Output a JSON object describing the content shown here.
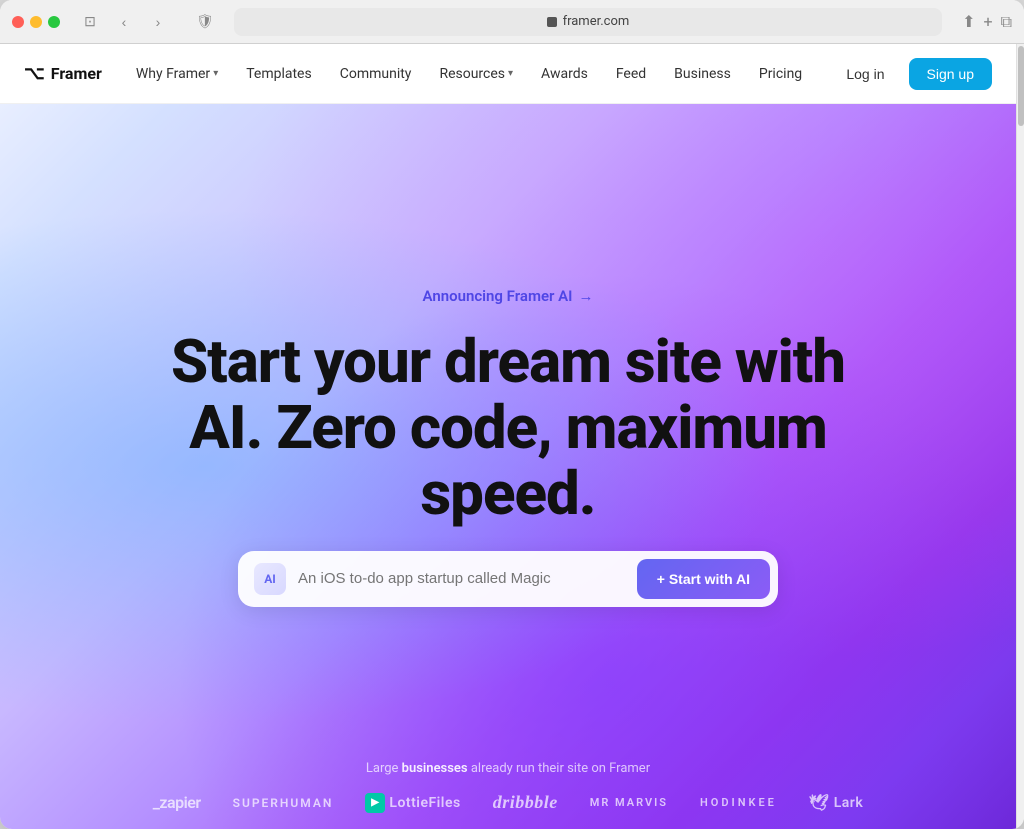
{
  "browser": {
    "url": "framer.com",
    "scrollbar_visible": true
  },
  "navbar": {
    "logo_label": "Framer",
    "links": [
      {
        "label": "Why Framer",
        "has_dropdown": true
      },
      {
        "label": "Templates",
        "has_dropdown": false
      },
      {
        "label": "Community",
        "has_dropdown": false
      },
      {
        "label": "Resources",
        "has_dropdown": true
      },
      {
        "label": "Awards",
        "has_dropdown": false
      },
      {
        "label": "Feed",
        "has_dropdown": false
      },
      {
        "label": "Business",
        "has_dropdown": false
      },
      {
        "label": "Pricing",
        "has_dropdown": false
      }
    ],
    "login_label": "Log in",
    "signup_label": "Sign up"
  },
  "hero": {
    "announce_text": "Announcing Framer AI",
    "announce_arrow": "→",
    "title": "Start your dream site with AI. Zero code, maximum speed.",
    "input_placeholder": "An iOS to-do app startup called Magic",
    "ai_icon_label": "AI",
    "cta_label": "+ Start with AI"
  },
  "brands": {
    "label_prefix": "Large ",
    "label_bold": "businesses",
    "label_suffix": " already run their site on Framer",
    "items": [
      {
        "name": "_zapier",
        "style": "zapier"
      },
      {
        "name": "SUPERHUMAN",
        "style": "superhuman"
      },
      {
        "name": "LottieFiles",
        "style": "lottiefiles"
      },
      {
        "name": "dribbble",
        "style": "dribbble"
      },
      {
        "name": "MR MARVIS",
        "style": "mrmarvis"
      },
      {
        "name": "HODINKEE",
        "style": "hodinkee"
      },
      {
        "name": "Lark",
        "style": "lark"
      }
    ]
  }
}
